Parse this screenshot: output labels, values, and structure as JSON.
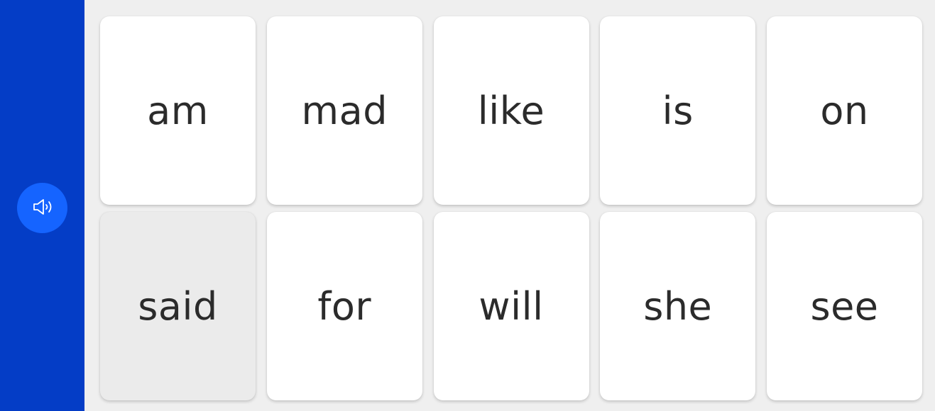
{
  "sidebar": {
    "speaker_icon": "speaker-icon",
    "colors": {
      "background": "#043dc6",
      "button": "#1564ff"
    }
  },
  "cards": [
    {
      "word": "am",
      "selected": false
    },
    {
      "word": "mad",
      "selected": false
    },
    {
      "word": "like",
      "selected": false
    },
    {
      "word": "is",
      "selected": false
    },
    {
      "word": "on",
      "selected": false
    },
    {
      "word": "said",
      "selected": true
    },
    {
      "word": "for",
      "selected": false
    },
    {
      "word": "will",
      "selected": false
    },
    {
      "word": "she",
      "selected": false
    },
    {
      "word": "see",
      "selected": false
    }
  ]
}
